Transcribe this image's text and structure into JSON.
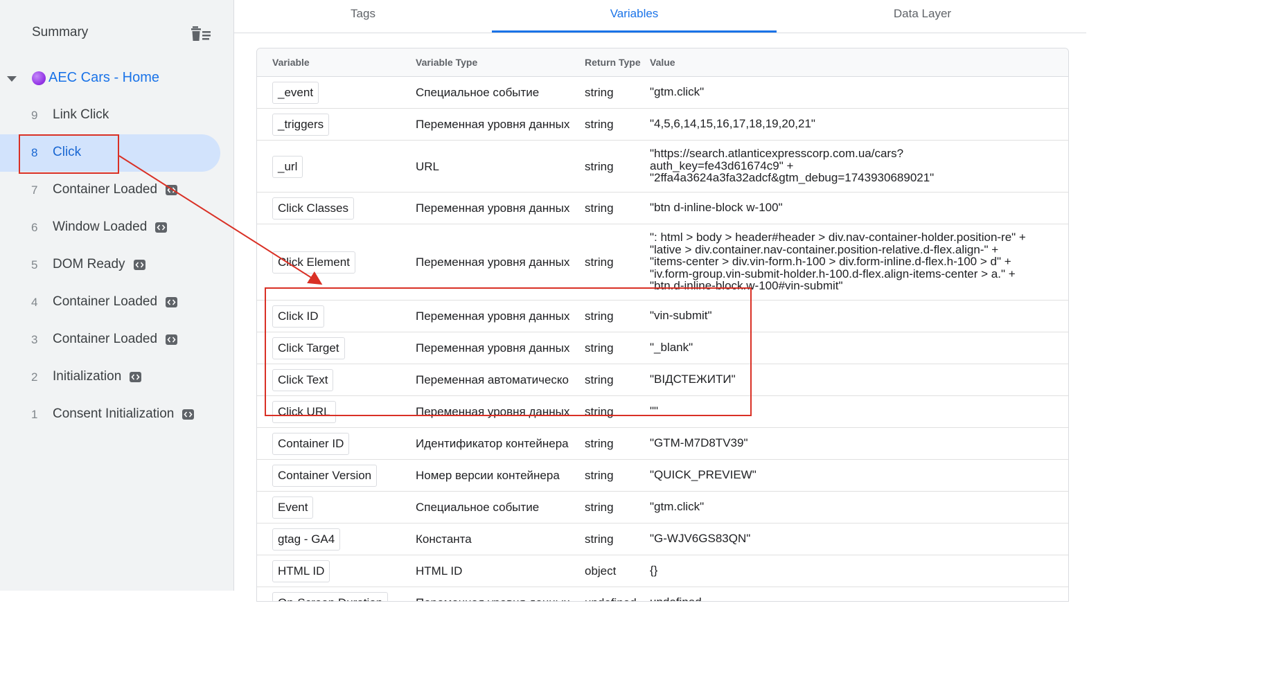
{
  "sidebar": {
    "summary_label": "Summary",
    "summary_icon": "clear-list-icon",
    "container_label": "AEC Cars - Home",
    "events": [
      {
        "num": "9",
        "label": "Link Click",
        "badge": false,
        "selected": false
      },
      {
        "num": "8",
        "label": "Click",
        "badge": false,
        "selected": true
      },
      {
        "num": "7",
        "label": "Container Loaded",
        "badge": true,
        "selected": false
      },
      {
        "num": "6",
        "label": "Window Loaded",
        "badge": true,
        "selected": false
      },
      {
        "num": "5",
        "label": "DOM Ready",
        "badge": true,
        "selected": false
      },
      {
        "num": "4",
        "label": "Container Loaded",
        "badge": true,
        "selected": false
      },
      {
        "num": "3",
        "label": "Container Loaded",
        "badge": true,
        "selected": false
      },
      {
        "num": "2",
        "label": "Initialization",
        "badge": true,
        "selected": false
      },
      {
        "num": "1",
        "label": "Consent Initialization",
        "badge": true,
        "selected": false
      }
    ]
  },
  "tabs": [
    {
      "label": "Tags",
      "active": false
    },
    {
      "label": "Variables",
      "active": true
    },
    {
      "label": "Data Layer",
      "active": false
    }
  ],
  "table": {
    "headers": {
      "variable": "Variable",
      "variable_type": "Variable Type",
      "return_type": "Return Type",
      "value": "Value"
    },
    "rows": [
      {
        "name": "_event",
        "type": "Специальное событие",
        "ret": "string",
        "value": "\"gtm.click\""
      },
      {
        "name": "_triggers",
        "type": "Переменная уровня данных",
        "ret": "string",
        "value": "\"4,5,6,14,15,16,17,18,19,20,21\""
      },
      {
        "name": "_url",
        "type": "URL",
        "ret": "string",
        "value": "\"https://search.atlanticexpresscorp.com.ua/cars?\nauth_key=fe43d61674c9\" +\n\"2ffa4a3624a3fa32adcf&gtm_debug=1743930689021\""
      },
      {
        "name": "Click Classes",
        "type": "Переменная уровня данных",
        "ret": "string",
        "value": "\"btn d-inline-block w-100\""
      },
      {
        "name": "Click Element",
        "type": "Переменная уровня данных",
        "ret": "string",
        "value": "\": html > body > header#header > div.nav-container-holder.position-re\" +\n\"lative > div.container.nav-container.position-relative.d-flex.align-\" +\n\"items-center > div.vin-form.h-100 > div.form-inline.d-flex.h-100 > d\" +\n\"iv.form-group.vin-submit-holder.h-100.d-flex.align-items-center > a.\" +\n\"btn.d-inline-block.w-100#vin-submit\""
      },
      {
        "name": "Click ID",
        "type": "Переменная уровня данных",
        "ret": "string",
        "value": "\"vin-submit\""
      },
      {
        "name": "Click Target",
        "type": "Переменная уровня данных",
        "ret": "string",
        "value": "\"_blank\""
      },
      {
        "name": "Click Text",
        "type": "Переменная автоматическо",
        "ret": "string",
        "value": "\"ВІДСТЕЖИТИ\""
      },
      {
        "name": "Click URL",
        "type": "Переменная уровня данных",
        "ret": "string",
        "value": "\"\""
      },
      {
        "name": "Container ID",
        "type": "Идентификатор контейнера",
        "ret": "string",
        "value": "\"GTM-M7D8TV39\""
      },
      {
        "name": "Container Version",
        "type": "Номер версии контейнера",
        "ret": "string",
        "value": "\"QUICK_PREVIEW\""
      },
      {
        "name": "Event",
        "type": "Специальное событие",
        "ret": "string",
        "value": "\"gtm.click\""
      },
      {
        "name": "gtag - GA4",
        "type": "Константа",
        "ret": "string",
        "value": "\"G-WJV6GS83QN\""
      },
      {
        "name": "HTML ID",
        "type": "HTML ID",
        "ret": "object",
        "value": "{}"
      },
      {
        "name": "On-Screen Duration",
        "type": "Переменная уровня данных",
        "ret": "undefined",
        "value": "undefined"
      }
    ]
  },
  "colors": {
    "accent": "#1a73e8",
    "annotation_red": "#d93025",
    "sidebar_bg": "#f1f3f4",
    "selected_bg": "#d2e3fc"
  }
}
